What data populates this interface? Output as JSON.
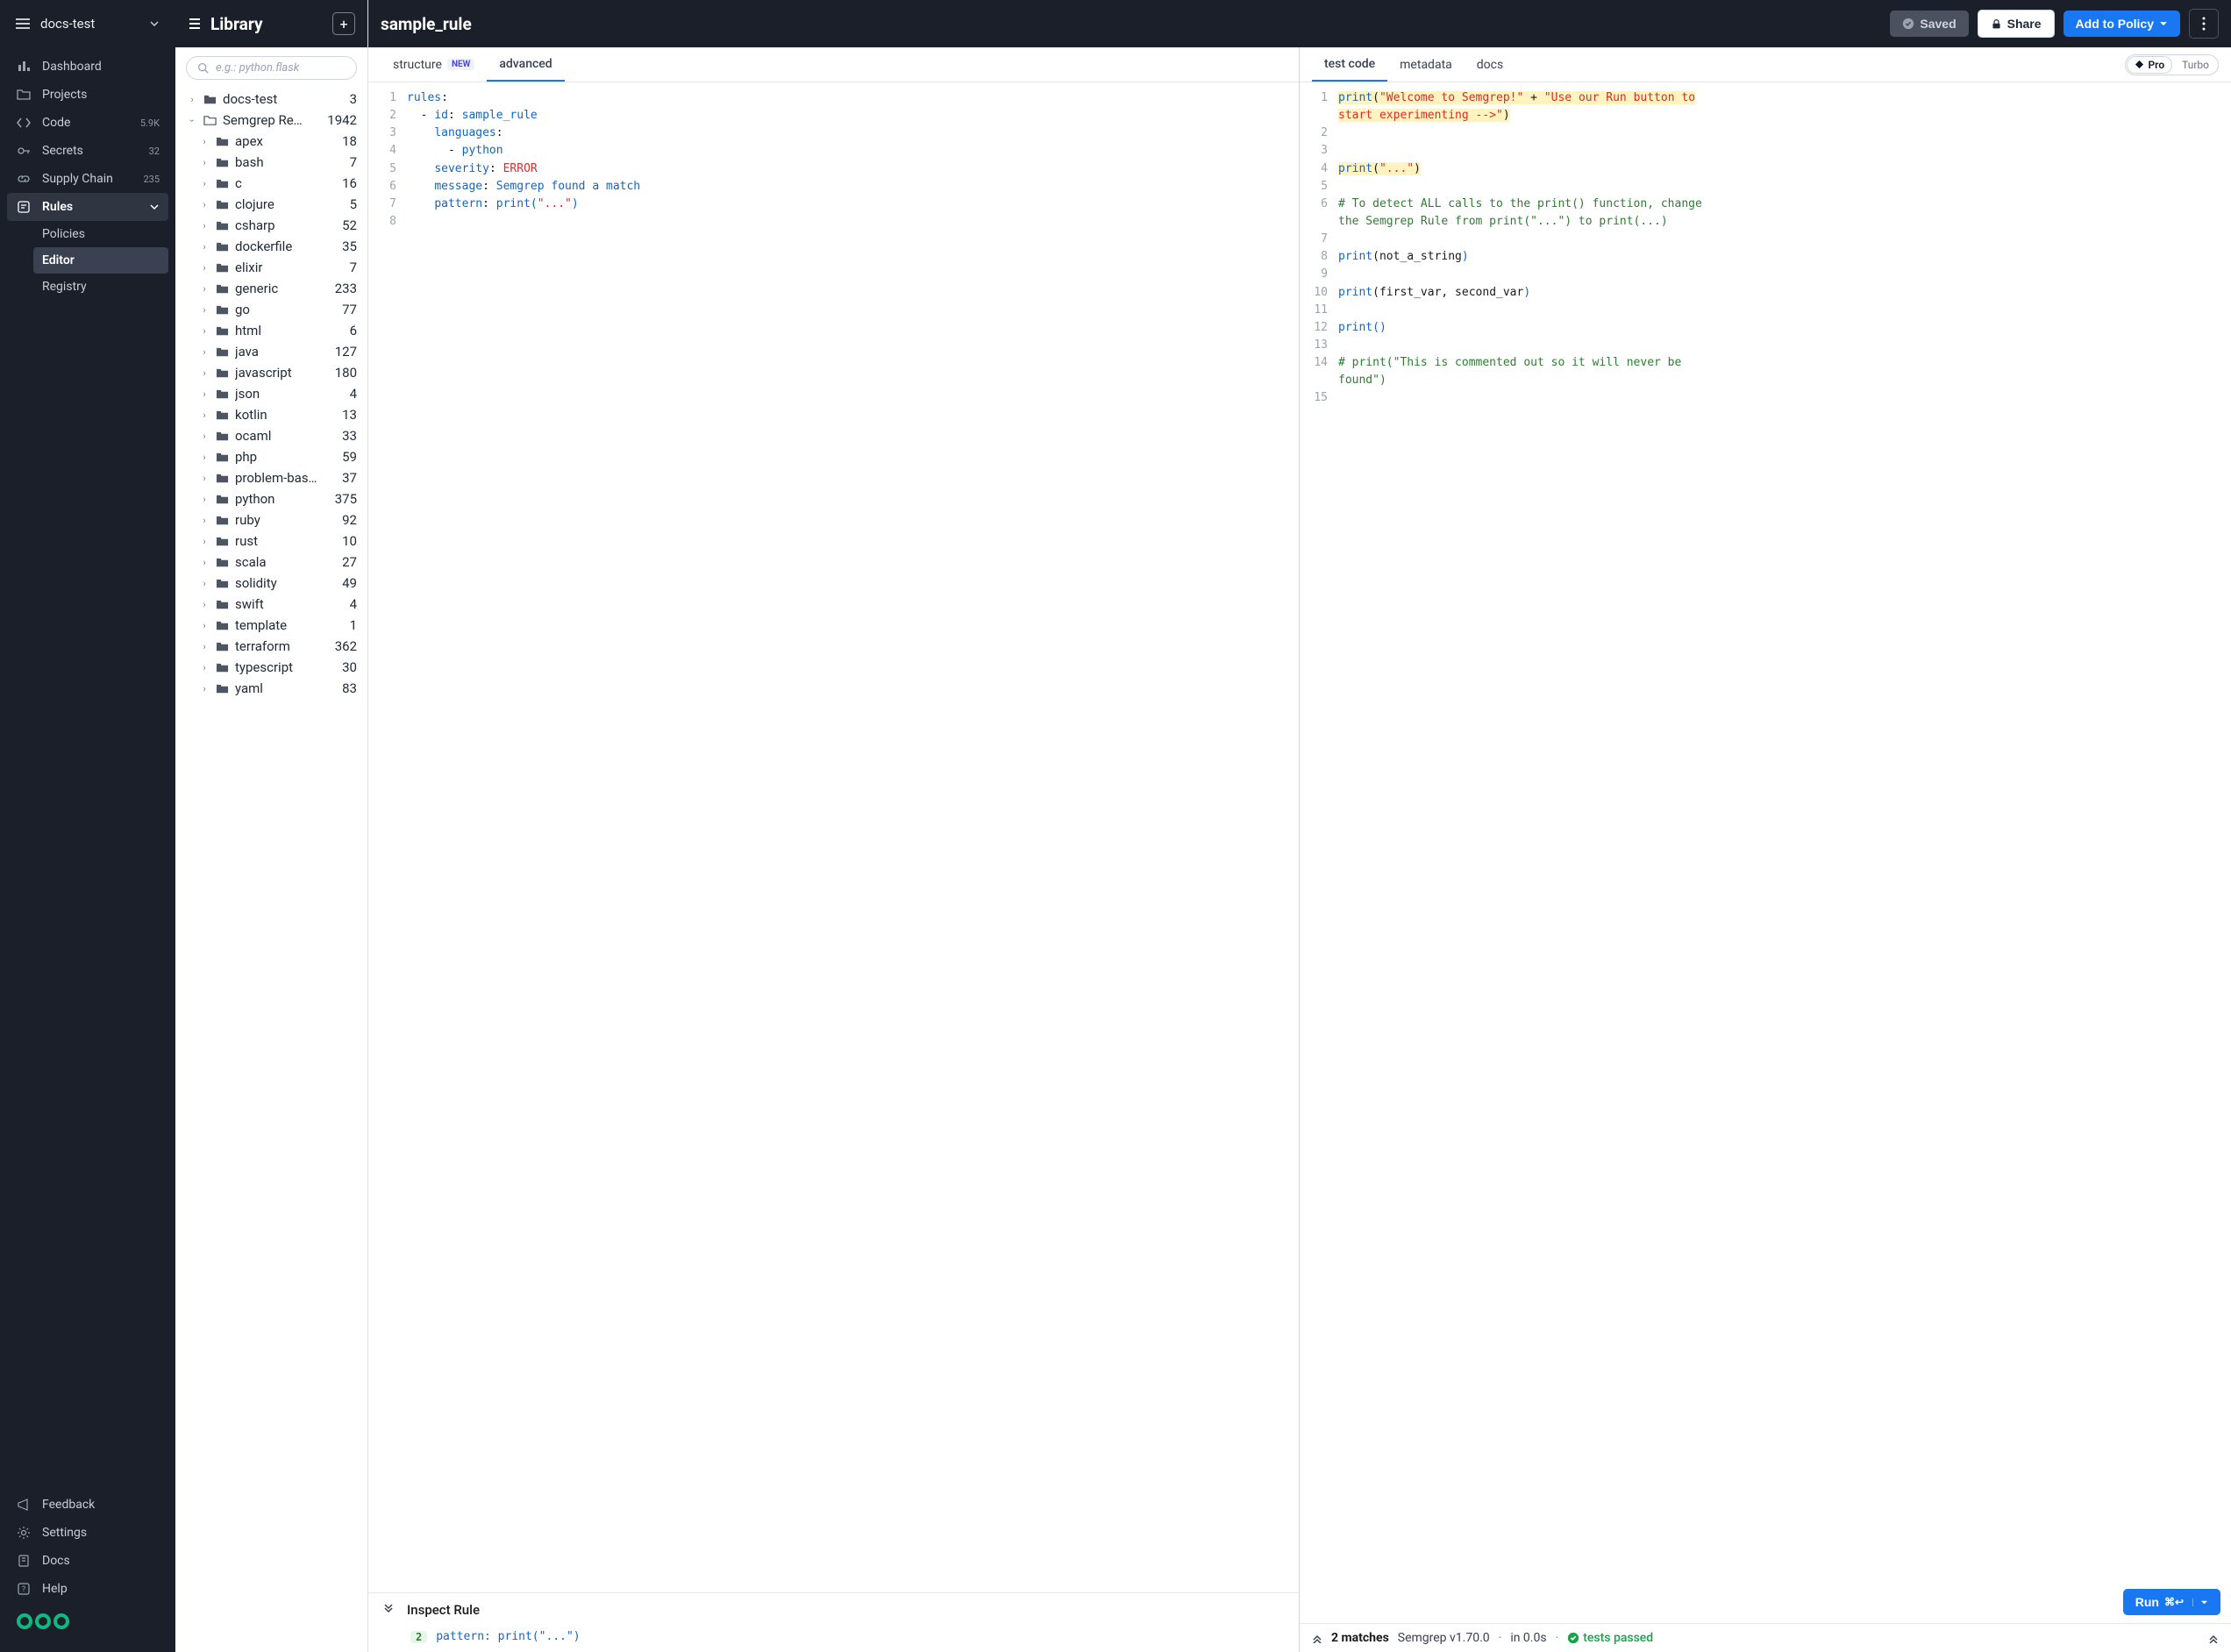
{
  "org": {
    "name": "docs-test"
  },
  "nav": {
    "dashboard": "Dashboard",
    "projects": "Projects",
    "code": "Code",
    "code_count": "5.9K",
    "secrets": "Secrets",
    "secrets_count": "32",
    "supply": "Supply Chain",
    "supply_count": "235",
    "rules": "Rules",
    "policies": "Policies",
    "editor": "Editor",
    "registry": "Registry",
    "feedback": "Feedback",
    "settings": "Settings",
    "docs": "Docs",
    "help": "Help"
  },
  "library": {
    "title": "Library",
    "search_placeholder": "e.g.: python.flask",
    "root1": {
      "label": "docs-test",
      "count": "3"
    },
    "root2": {
      "label": "Semgrep Re…",
      "count": "1942"
    },
    "children": [
      {
        "label": "apex",
        "count": "18"
      },
      {
        "label": "bash",
        "count": "7"
      },
      {
        "label": "c",
        "count": "16"
      },
      {
        "label": "clojure",
        "count": "5"
      },
      {
        "label": "csharp",
        "count": "52"
      },
      {
        "label": "dockerfile",
        "count": "35"
      },
      {
        "label": "elixir",
        "count": "7"
      },
      {
        "label": "generic",
        "count": "233"
      },
      {
        "label": "go",
        "count": "77"
      },
      {
        "label": "html",
        "count": "6"
      },
      {
        "label": "java",
        "count": "127"
      },
      {
        "label": "javascript",
        "count": "180"
      },
      {
        "label": "json",
        "count": "4"
      },
      {
        "label": "kotlin",
        "count": "13"
      },
      {
        "label": "ocaml",
        "count": "33"
      },
      {
        "label": "php",
        "count": "59"
      },
      {
        "label": "problem-bas…",
        "count": "37"
      },
      {
        "label": "python",
        "count": "375"
      },
      {
        "label": "ruby",
        "count": "92"
      },
      {
        "label": "rust",
        "count": "10"
      },
      {
        "label": "scala",
        "count": "27"
      },
      {
        "label": "solidity",
        "count": "49"
      },
      {
        "label": "swift",
        "count": "4"
      },
      {
        "label": "template",
        "count": "1"
      },
      {
        "label": "terraform",
        "count": "362"
      },
      {
        "label": "typescript",
        "count": "30"
      },
      {
        "label": "yaml",
        "count": "83"
      }
    ]
  },
  "editor": {
    "rule_name": "sample_rule",
    "saved": "Saved",
    "share": "Share",
    "add_policy": "Add to Policy",
    "tabs_left": {
      "structure": "structure",
      "new": "NEW",
      "advanced": "advanced"
    },
    "tabs_right": {
      "test": "test code",
      "metadata": "metadata",
      "docs": "docs"
    },
    "engine": {
      "pro": "Pro",
      "turbo": "Turbo"
    },
    "inspect": {
      "title": "Inspect Rule",
      "count": "2",
      "pattern": "pattern: print(\"...\")"
    },
    "run": "Run",
    "status": {
      "matches": "2 matches",
      "version": "Semgrep v1.70.0",
      "time": "in 0.0s",
      "pass": "tests passed"
    }
  }
}
